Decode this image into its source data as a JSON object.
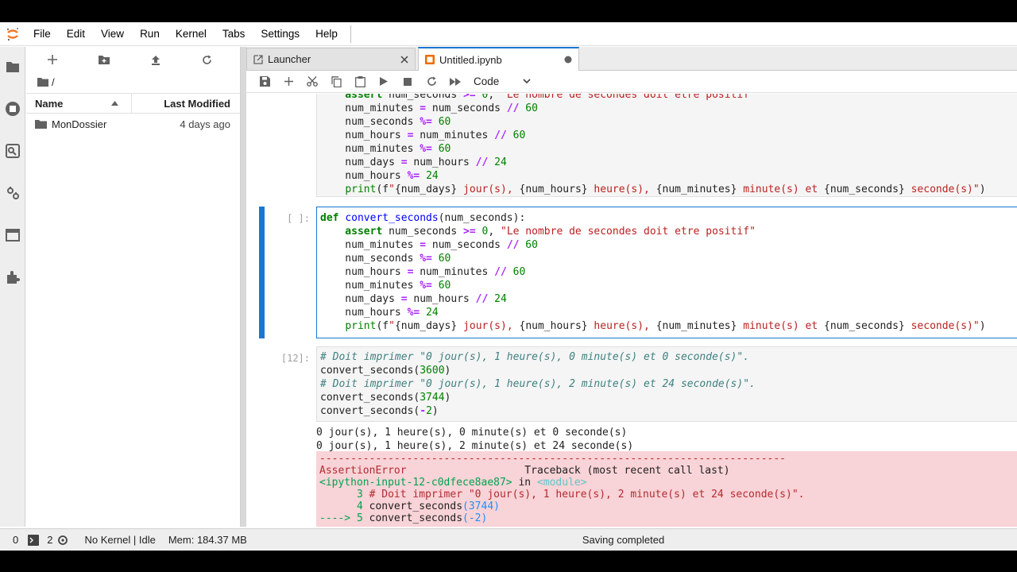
{
  "menubar": {
    "items": [
      "File",
      "Edit",
      "View",
      "Run",
      "Kernel",
      "Tabs",
      "Settings",
      "Help"
    ]
  },
  "filebrowser": {
    "path": "/",
    "col_name": "Name",
    "col_modified": "Last Modified",
    "rows": [
      {
        "name": "MonDossier",
        "modified": "4 days ago"
      }
    ]
  },
  "tabs": [
    {
      "label": "Launcher"
    },
    {
      "label": "Untitled.ipynb"
    }
  ],
  "toolbar": {
    "cell_type": "Code"
  },
  "cells": {
    "c1_lines": [
      "    assert num_seconds >= 0, \"Le nombre de secondes doit etre positif\"",
      "    num_minutes = num_seconds // 60",
      "    num_seconds %= 60",
      "    num_hours = num_minutes // 60",
      "    num_minutes %= 60",
      "    num_days = num_hours // 24",
      "    num_hours %= 24",
      "    print(f\"{num_days} jour(s), {num_hours} heure(s), {num_minutes} minute(s) et {num_seconds} seconde(s)\")"
    ],
    "c2_prompt": "[ ]:",
    "c3_prompt": "[12]:",
    "c3_out1": "0 jour(s), 1 heure(s), 0 minute(s) et 0 seconde(s)",
    "c3_out2": "0 jour(s), 1 heure(s), 2 minute(s) et 24 seconde(s)",
    "traceback": {
      "dashes": "---------------------------------------------------------------------------",
      "error": "AssertionError",
      "title": "Traceback (most recent call last)",
      "input": "<ipython-input-12-c0dfece8ae87>",
      "in": " in ",
      "module": "<module>",
      "l3_num": "      3 ",
      "l3_text": "# Doit imprimer \"0 jour(s), 1 heure(s), 2 minute(s) et 24 seconde(s)\".",
      "l4_num": "      4 ",
      "l4_text": "convert_seconds",
      "l4_arg": "(3744)",
      "l5_arrow": "----> 5 ",
      "l5_text": "convert_seconds",
      "l5_arg": "(-2)"
    }
  },
  "statusbar": {
    "count1": "0",
    "count2": "2",
    "kernel": "No Kernel | Idle",
    "mem": "Mem: 184.37 MB",
    "saving": "Saving completed"
  }
}
